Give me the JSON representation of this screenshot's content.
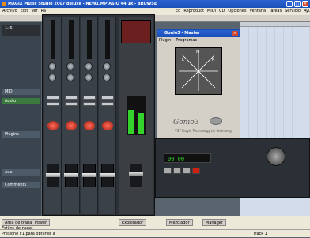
{
  "app": {
    "title": "MAGIX Music Studio 2007 deluxe - NEW1.MP  ASIO 44.1k - BROWSE"
  },
  "menu": {
    "items": [
      "Archivo",
      "Edit",
      "Ver",
      "Ra",
      "Ed",
      "Reproduct",
      "MIDI",
      "CD",
      "Opciones",
      "Ventana",
      "Tareas",
      "Servicio",
      "Ayu"
    ]
  },
  "tracks": {
    "items": [
      {
        "label": "1: S"
      },
      {
        "label": "MIDI"
      },
      {
        "label": "Audio"
      },
      {
        "label": "Plugins"
      },
      {
        "label": "Aux"
      },
      {
        "label": "Comments"
      }
    ]
  },
  "goniometer": {
    "window_title": "Gonio3 - Master",
    "menu": [
      "Plugin",
      "Programas"
    ],
    "labels": {
      "l": "L",
      "m": "M",
      "r": "R"
    },
    "brand": "Gonio3",
    "footer": "VST Plugin Technology by Steinberg"
  },
  "transport": {
    "counter": "00:00"
  },
  "panels": {
    "tabs": [
      {
        "label": "Área de trabajo"
      },
      {
        "label": "Power"
      },
      {
        "label": "Explorador"
      },
      {
        "label": "Mezclador"
      },
      {
        "label": "Manager"
      }
    ],
    "sub_tab": "Estilos de panel"
  },
  "status": {
    "text": "Presione F1 para obtener a",
    "track": "Track 1"
  },
  "colors": {
    "accent": "#1a4fb8",
    "record": "#d02010",
    "meter": "#35d12c"
  }
}
